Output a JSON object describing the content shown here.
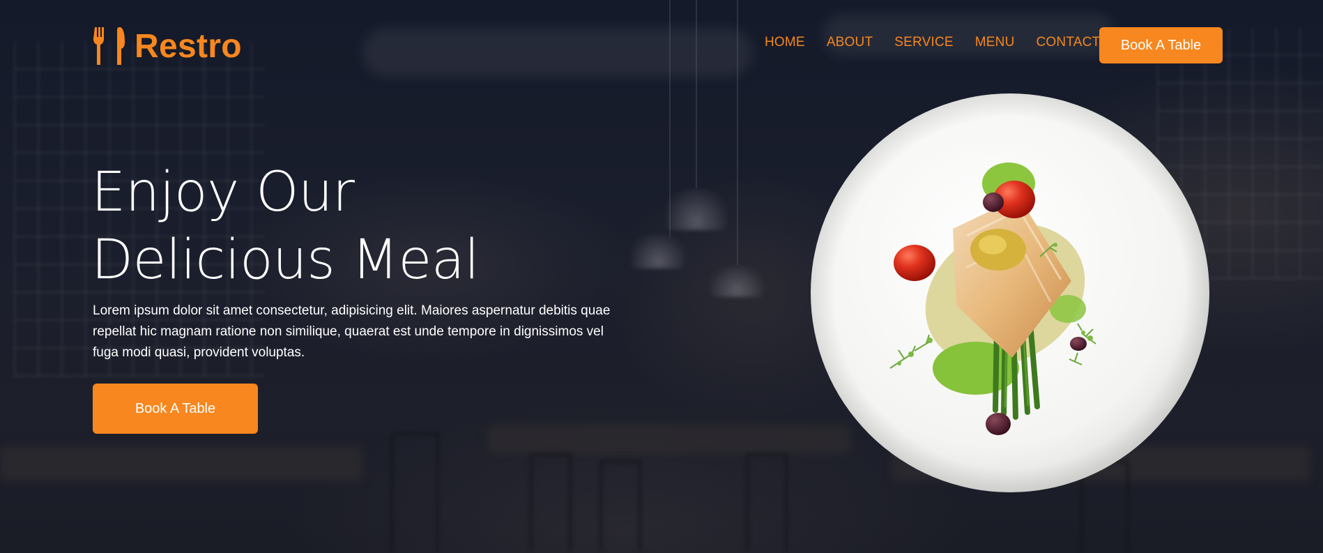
{
  "brand": {
    "name": "Restro",
    "icon": "utensils-icon",
    "accent_color": "#f7871e"
  },
  "nav": {
    "links": [
      "HOME",
      "ABOUT",
      "SERVICE",
      "MENU",
      "CONTACT"
    ],
    "cta_label": "Book A Table"
  },
  "hero": {
    "headline_line1": "Enjoy Our",
    "headline_line2": "Delicious Meal",
    "description": "Lorem ipsum dolor sit amet consectetur, adipisicing elit. Maiores aspernatur debitis quae repellat hic magnam ratione non similique, quaerat est unde tempore in dignissimos vel fuga modi quasi, provident voluptas.",
    "cta_label": "Book A Table",
    "image": "plated-salmon-dish"
  },
  "colors": {
    "background": "#121726",
    "text": "#ffffff",
    "button": "#f7871e"
  }
}
